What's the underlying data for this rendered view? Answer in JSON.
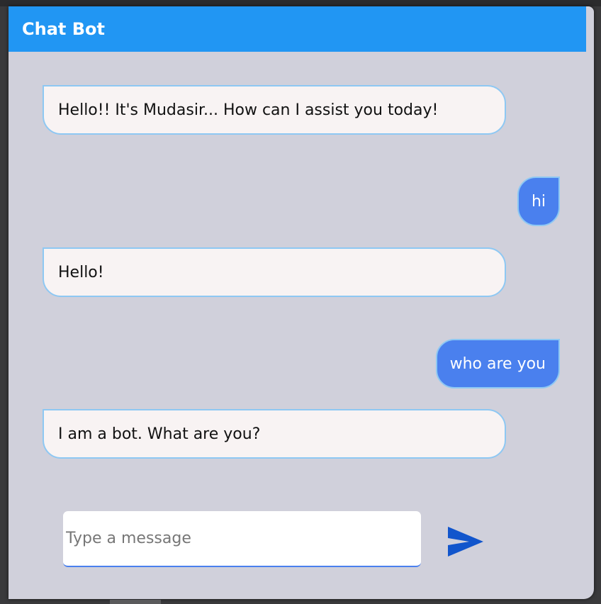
{
  "header": {
    "title": "Chat Bot"
  },
  "messages": [
    {
      "sender": "bot",
      "text": "Hello!! It's Mudasir... How can I assist you today!"
    },
    {
      "sender": "user",
      "text": "hi"
    },
    {
      "sender": "bot",
      "text": "Hello!"
    },
    {
      "sender": "user",
      "text": "who are you"
    },
    {
      "sender": "bot",
      "text": "I am a bot. What are you?"
    }
  ],
  "composer": {
    "placeholder": "Type a message",
    "value": "",
    "send_icon": "send-arrow-icon"
  },
  "colors": {
    "header": "#2196f3",
    "user_bubble": "#4a80ee",
    "bot_bubble": "#f8f3f3",
    "background": "#d0d0db",
    "send_icon": "#1155cc"
  }
}
